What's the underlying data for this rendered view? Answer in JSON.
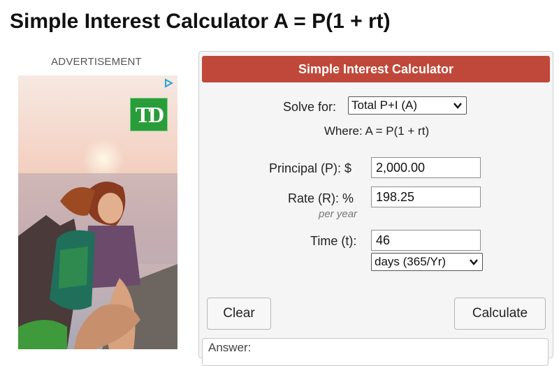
{
  "page": {
    "title": "Simple Interest Calculator A = P(1 + rt)"
  },
  "ad": {
    "label": "ADVERTISEMENT",
    "logo_text": "TD",
    "choices_icon": "ad-choices-icon"
  },
  "calculator": {
    "header": "Simple Interest Calculator",
    "solve_for_label": "Solve for:",
    "solve_for_value": "Total P+I (A)",
    "formula": "Where: A = P(1 + rt)",
    "principal_label": "Principal (P): $",
    "principal_value": "2,000.00",
    "rate_label": "Rate (R): %",
    "rate_value": "198.25",
    "rate_sublabel": "per year",
    "time_label": "Time (t):",
    "time_value": "46",
    "time_unit_value": "days (365/Yr)",
    "clear_label": "Clear",
    "calculate_label": "Calculate",
    "answer_label": "Answer:"
  },
  "colors": {
    "header_bg": "#c0483a",
    "td_green": "#2a9d3b"
  }
}
